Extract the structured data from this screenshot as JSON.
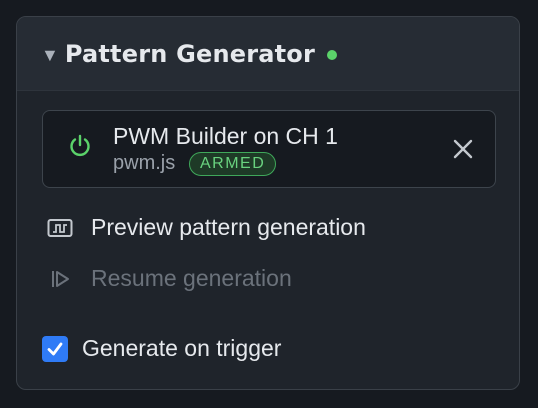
{
  "panel": {
    "title": "Pattern Generator",
    "status_color": "#5bd36a"
  },
  "script": {
    "title": "PWM Builder on CH 1",
    "file": "pwm.js",
    "badge": "ARMED",
    "icon": "power-icon"
  },
  "actions": [
    {
      "label": "Preview pattern generation",
      "icon": "waveform-icon",
      "enabled": true
    },
    {
      "label": "Resume generation",
      "icon": "play-icon",
      "enabled": false
    }
  ],
  "checkbox": {
    "label": "Generate on trigger",
    "checked": true
  },
  "colors": {
    "accent": "#2f7bf6",
    "armed": "#69d27f"
  }
}
